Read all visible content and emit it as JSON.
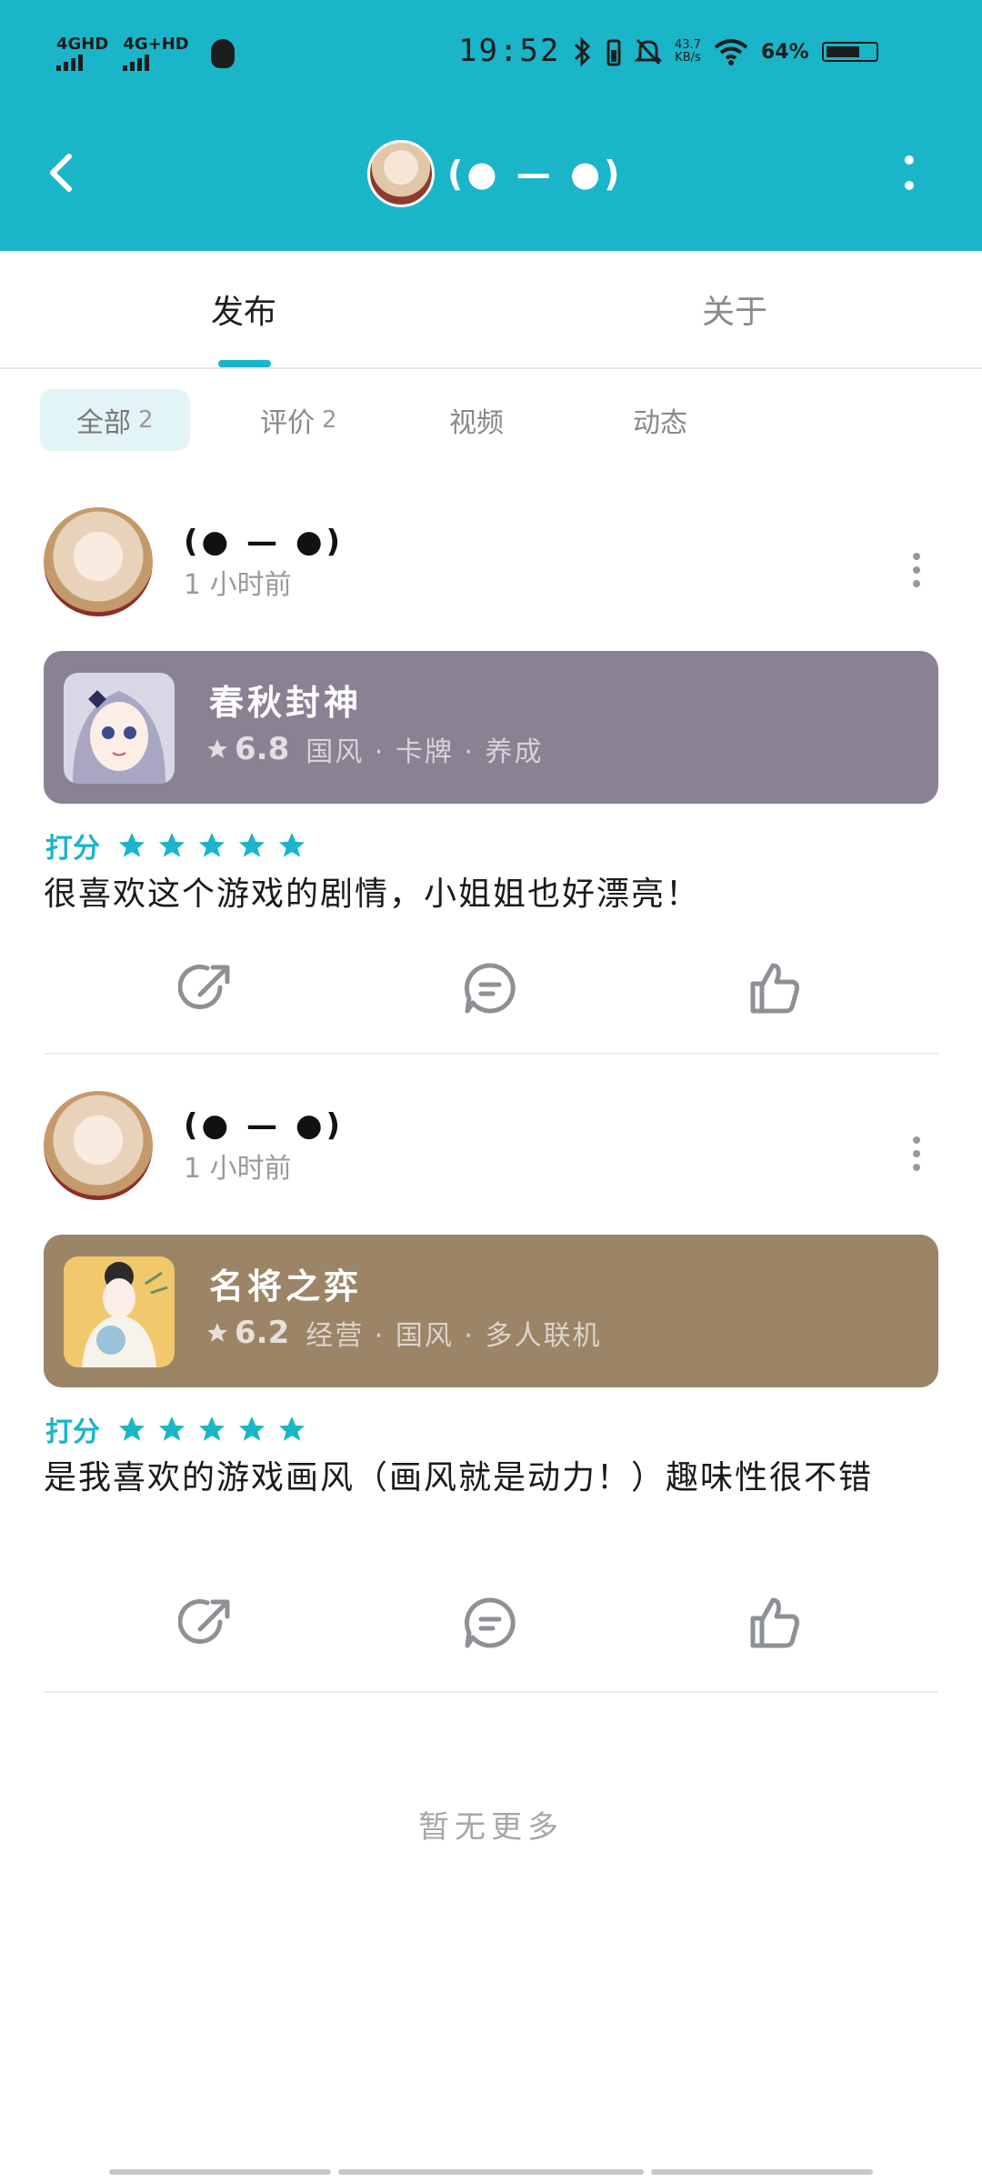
{
  "status_bar": {
    "net1": "4GHD",
    "net2": "4G+HD",
    "time": "19:52",
    "speed_top": "43.7",
    "speed_bottom": "KB/s",
    "battery": "64%"
  },
  "header": {
    "title": "(● — ●)",
    "back_icon": "chevron-left-icon",
    "more_icon": "vertical-dots-icon"
  },
  "tabs": [
    {
      "label": "发布",
      "active": true
    },
    {
      "label": "关于",
      "active": false
    }
  ],
  "chips": [
    {
      "label": "全部",
      "count": "2",
      "active": true
    },
    {
      "label": "评价",
      "count": "2",
      "active": false
    },
    {
      "label": "视频",
      "count": "",
      "active": false
    },
    {
      "label": "动态",
      "count": "",
      "active": false
    }
  ],
  "posts": [
    {
      "author": "(● — ●)",
      "time": "1 小时前",
      "game": {
        "title": "春秋封神",
        "score": "6.8",
        "tags": "国风 · 卡牌 · 养成",
        "card_color": "#8a8192"
      },
      "rating_label": "打分",
      "stars": 5,
      "text": "很喜欢这个游戏的剧情，小姐姐也好漂亮！"
    },
    {
      "author": "(● — ●)",
      "time": "1 小时前",
      "game": {
        "title": "名将之弈",
        "score": "6.2",
        "tags": "经营 · 国风 · 多人联机",
        "card_color": "#9c8467"
      },
      "rating_label": "打分",
      "stars": 5,
      "text": "是我喜欢的游戏画风（画风就是动力！）趣味性很不错"
    }
  ],
  "footer": {
    "no_more": "暂无更多"
  },
  "colors": {
    "accent": "#1ab5c8",
    "star": "#1ab5c8"
  }
}
